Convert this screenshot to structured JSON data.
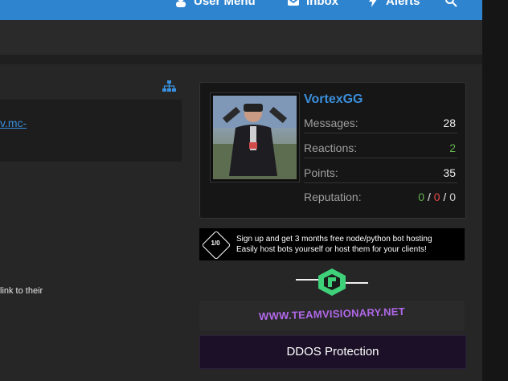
{
  "nav": {
    "user_menu": "User Menu",
    "inbox": "Inbox",
    "alerts": "Alerts"
  },
  "post": {
    "link_text": "v.mc-",
    "snippet": "link to their"
  },
  "profile": {
    "username": "VortexGG",
    "stats": [
      {
        "label": "Messages:",
        "value": "28",
        "color": "#f0f0f0"
      },
      {
        "label": "Reactions:",
        "value": "2",
        "color": "#63b24d"
      },
      {
        "label": "Points:",
        "value": "35",
        "color": "#f0f0f0"
      }
    ],
    "reputation": {
      "label": "Reputation:",
      "positive": "0",
      "negative": "0",
      "neutral": "0",
      "sep": "/"
    }
  },
  "ads": {
    "ad1": {
      "badge": "1/0",
      "line1": "Sign up and get 3 months free node/python bot hosting",
      "line2": "Easily host bots yourself or host them for your clients!"
    },
    "ad3": {
      "text": "WWW.TEAMVISIONARY.NET"
    },
    "ad4": {
      "text": "DDOS Protection"
    }
  },
  "colors": {
    "accent": "#2f84cf",
    "link": "#3a8fdc",
    "positive": "#63b24d",
    "negative": "#e04a4a"
  },
  "icons": {
    "user_menu": "user-icon",
    "inbox": "inbox-icon",
    "alerts": "bolt-icon",
    "search": "search-icon",
    "tree": "sitemap-icon"
  }
}
